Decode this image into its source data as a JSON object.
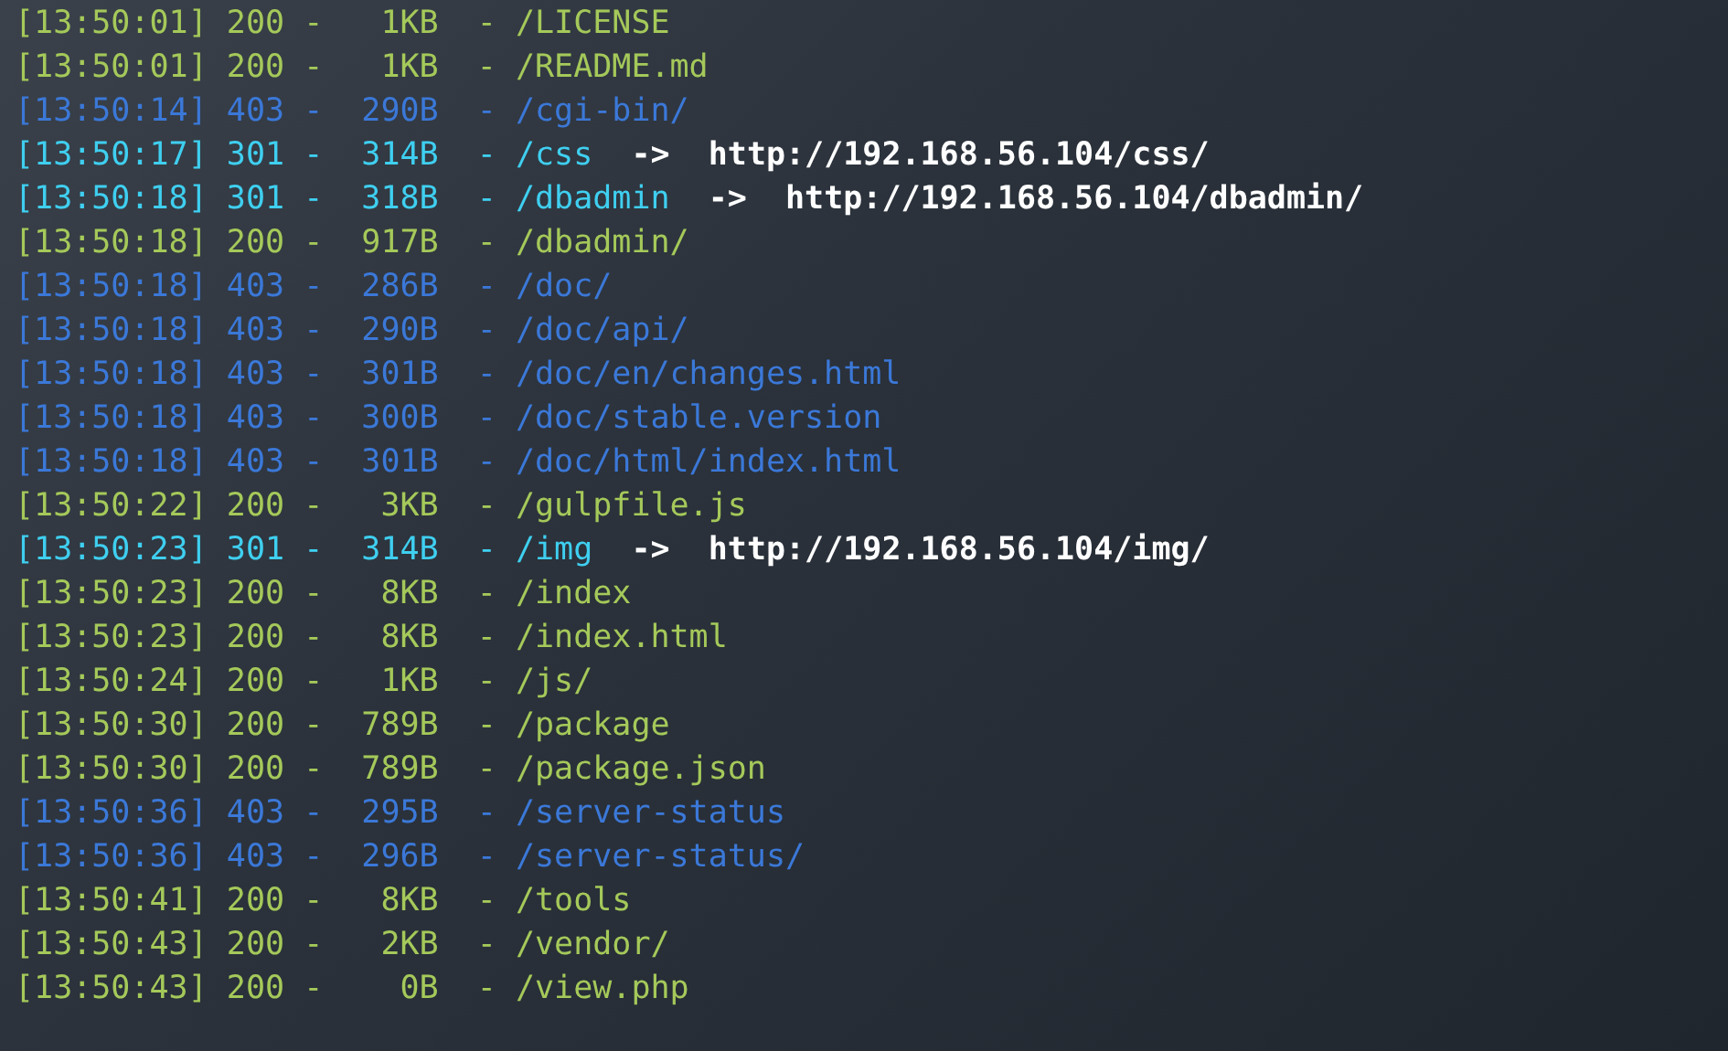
{
  "lines": [
    {
      "time": "[13:50:01]",
      "status": "200",
      "sep1": "-",
      "size": "1KB",
      "sep2": "-",
      "path": "/LICENSE",
      "color": "#a5c95a"
    },
    {
      "time": "[13:50:01]",
      "status": "200",
      "sep1": "-",
      "size": "1KB",
      "sep2": "-",
      "path": "/README.md",
      "color": "#a5c95a"
    },
    {
      "time": "[13:50:14]",
      "status": "403",
      "sep1": "-",
      "size": "290B",
      "sep2": "-",
      "path": "/cgi-bin/",
      "color": "#3b78d8"
    },
    {
      "time": "[13:50:17]",
      "status": "301",
      "sep1": "-",
      "size": "314B",
      "sep2": "-",
      "path": "/css",
      "color": "#3fcff0",
      "arrow": "->",
      "redirect": "http://192.168.56.104/css/"
    },
    {
      "time": "[13:50:18]",
      "status": "301",
      "sep1": "-",
      "size": "318B",
      "sep2": "-",
      "path": "/dbadmin",
      "color": "#3fcff0",
      "arrow": "->",
      "redirect": "http://192.168.56.104/dbadmin/"
    },
    {
      "time": "[13:50:18]",
      "status": "200",
      "sep1": "-",
      "size": "917B",
      "sep2": "-",
      "path": "/dbadmin/",
      "color": "#a5c95a"
    },
    {
      "time": "[13:50:18]",
      "status": "403",
      "sep1": "-",
      "size": "286B",
      "sep2": "-",
      "path": "/doc/",
      "color": "#3b78d8"
    },
    {
      "time": "[13:50:18]",
      "status": "403",
      "sep1": "-",
      "size": "290B",
      "sep2": "-",
      "path": "/doc/api/",
      "color": "#3b78d8"
    },
    {
      "time": "[13:50:18]",
      "status": "403",
      "sep1": "-",
      "size": "301B",
      "sep2": "-",
      "path": "/doc/en/changes.html",
      "color": "#3b78d8"
    },
    {
      "time": "[13:50:18]",
      "status": "403",
      "sep1": "-",
      "size": "300B",
      "sep2": "-",
      "path": "/doc/stable.version",
      "color": "#3b78d8"
    },
    {
      "time": "[13:50:18]",
      "status": "403",
      "sep1": "-",
      "size": "301B",
      "sep2": "-",
      "path": "/doc/html/index.html",
      "color": "#3b78d8"
    },
    {
      "time": "[13:50:22]",
      "status": "200",
      "sep1": "-",
      "size": "3KB",
      "sep2": "-",
      "path": "/gulpfile.js",
      "color": "#a5c95a"
    },
    {
      "time": "[13:50:23]",
      "status": "301",
      "sep1": "-",
      "size": "314B",
      "sep2": "-",
      "path": "/img",
      "color": "#3fcff0",
      "arrow": "->",
      "redirect": "http://192.168.56.104/img/"
    },
    {
      "time": "[13:50:23]",
      "status": "200",
      "sep1": "-",
      "size": "8KB",
      "sep2": "-",
      "path": "/index",
      "color": "#a5c95a"
    },
    {
      "time": "[13:50:23]",
      "status": "200",
      "sep1": "-",
      "size": "8KB",
      "sep2": "-",
      "path": "/index.html",
      "color": "#a5c95a"
    },
    {
      "time": "[13:50:24]",
      "status": "200",
      "sep1": "-",
      "size": "1KB",
      "sep2": "-",
      "path": "/js/",
      "color": "#a5c95a"
    },
    {
      "time": "[13:50:30]",
      "status": "200",
      "sep1": "-",
      "size": "789B",
      "sep2": "-",
      "path": "/package",
      "color": "#a5c95a"
    },
    {
      "time": "[13:50:30]",
      "status": "200",
      "sep1": "-",
      "size": "789B",
      "sep2": "-",
      "path": "/package.json",
      "color": "#a5c95a"
    },
    {
      "time": "[13:50:36]",
      "status": "403",
      "sep1": "-",
      "size": "295B",
      "sep2": "-",
      "path": "/server-status",
      "color": "#3b78d8"
    },
    {
      "time": "[13:50:36]",
      "status": "403",
      "sep1": "-",
      "size": "296B",
      "sep2": "-",
      "path": "/server-status/",
      "color": "#3b78d8"
    },
    {
      "time": "[13:50:41]",
      "status": "200",
      "sep1": "-",
      "size": "8KB",
      "sep2": "-",
      "path": "/tools",
      "color": "#a5c95a"
    },
    {
      "time": "[13:50:43]",
      "status": "200",
      "sep1": "-",
      "size": "2KB",
      "sep2": "-",
      "path": "/vendor/",
      "color": "#a5c95a"
    },
    {
      "time": "[13:50:43]",
      "status": "200",
      "sep1": "-",
      "size": "0B",
      "sep2": "-",
      "path": "/view.php",
      "color": "#a5c95a"
    }
  ]
}
